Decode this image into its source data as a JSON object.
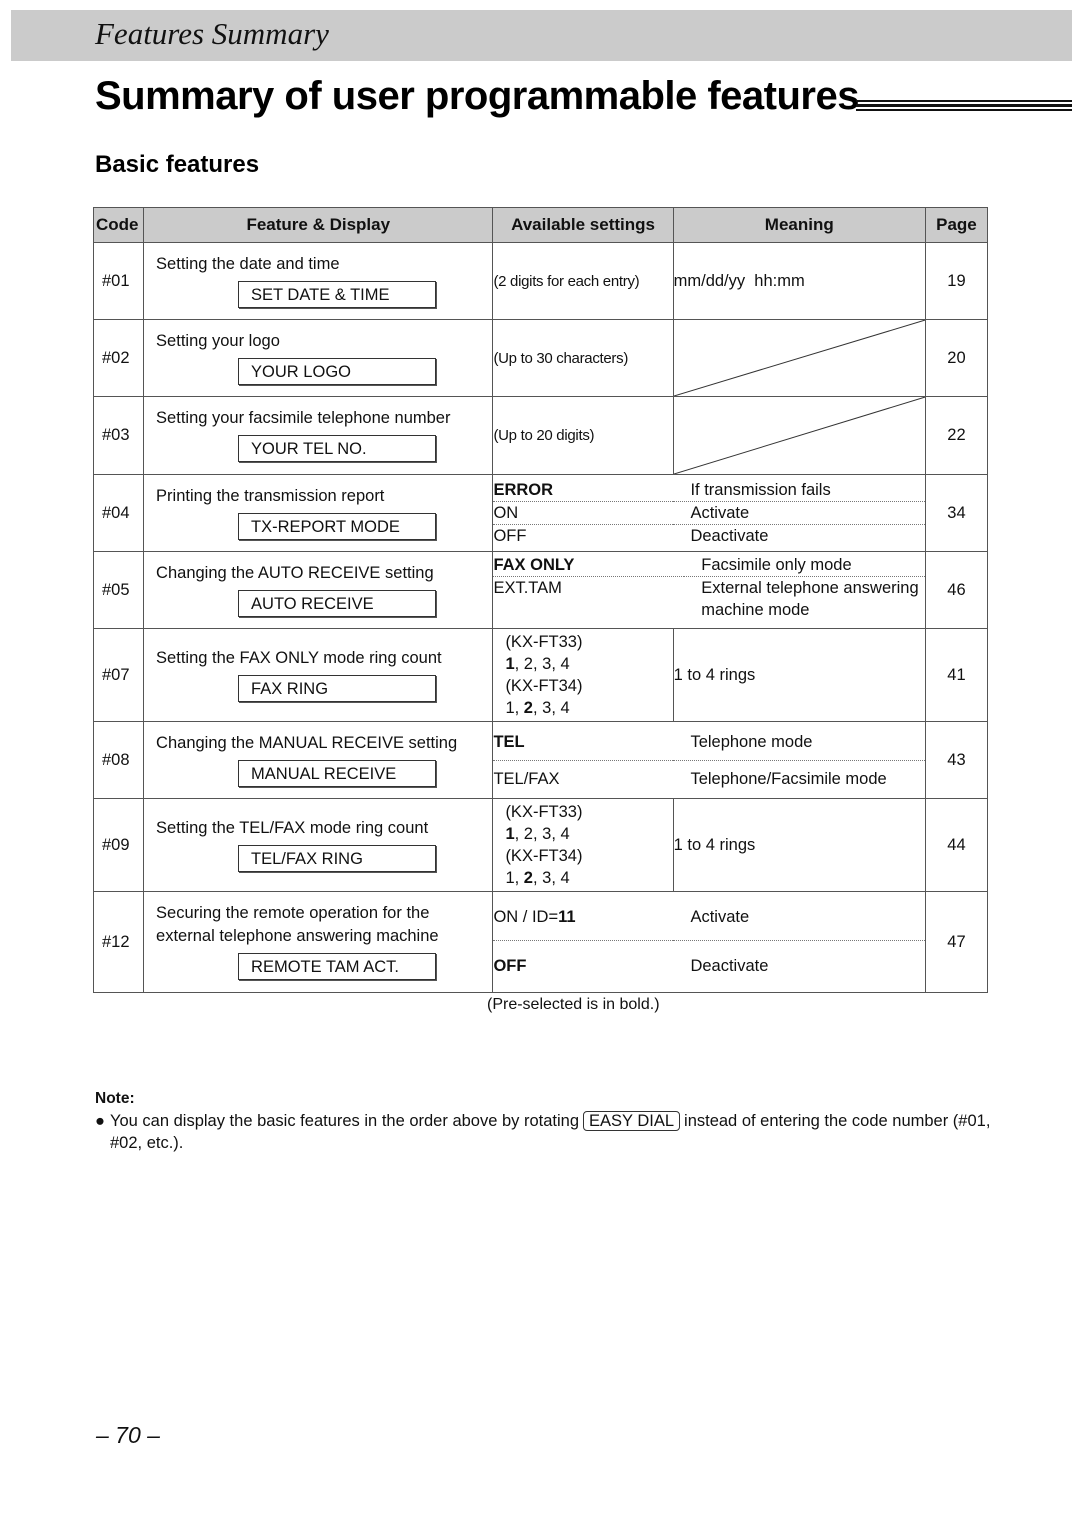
{
  "header": {
    "section": "Features Summary"
  },
  "main_title": "Summary of user programmable features",
  "section_title": "Basic features",
  "table": {
    "headers": {
      "code": "Code",
      "feature": "Feature & Display",
      "settings": "Available settings",
      "meaning": "Meaning",
      "page": "Page"
    },
    "rows": [
      {
        "code": "#01",
        "description": "Setting the date and time",
        "display": "SET DATE & TIME",
        "settings": "(2 digits for each entry)",
        "meaning": "mm/dd/yy  hh:mm",
        "page": "19"
      },
      {
        "code": "#02",
        "description": "Setting your logo",
        "display": "YOUR LOGO",
        "settings": "(Up to 30 characters)",
        "meaning": "",
        "page": "20"
      },
      {
        "code": "#03",
        "description": "Setting your facsimile telephone number",
        "display": "YOUR TEL NO.",
        "settings": "(Up to 20 digits)",
        "meaning": "",
        "page": "22"
      },
      {
        "code": "#04",
        "description": "Printing the transmission report",
        "display": "TX-REPORT MODE",
        "options": [
          {
            "setting": "ERROR",
            "bold": true,
            "meaning": "If transmission fails"
          },
          {
            "setting": "ON",
            "bold": false,
            "meaning": "Activate"
          },
          {
            "setting": "OFF",
            "bold": false,
            "meaning": "Deactivate"
          }
        ],
        "page": "34"
      },
      {
        "code": "#05",
        "description": "Changing the AUTO RECEIVE setting",
        "display": "AUTO RECEIVE",
        "options": [
          {
            "setting": "FAX ONLY",
            "bold": true,
            "meaning": "Facsimile only mode"
          },
          {
            "setting": "EXT.TAM",
            "bold": false,
            "meaning": "External telephone answering machine mode"
          }
        ],
        "page": "46"
      },
      {
        "code": "#07",
        "description": "Setting the FAX ONLY mode ring count",
        "display": "FAX RING",
        "models": [
          {
            "model": "(KX-FT33)",
            "default": "1",
            "values": [
              "1",
              "2",
              "3",
              "4"
            ]
          },
          {
            "model": "(KX-FT34)",
            "default": "2",
            "values": [
              "1",
              "2",
              "3",
              "4"
            ]
          }
        ],
        "meaning": "1 to 4 rings",
        "page": "41"
      },
      {
        "code": "#08",
        "description": "Changing the MANUAL RECEIVE setting",
        "display": "MANUAL RECEIVE",
        "options": [
          {
            "setting": "TEL",
            "bold": true,
            "meaning": "Telephone mode"
          },
          {
            "setting": "TEL/FAX",
            "bold": false,
            "meaning": "Telephone/Facsimile mode"
          }
        ],
        "page": "43"
      },
      {
        "code": "#09",
        "description": "Setting the TEL/FAX mode ring count",
        "display": "TEL/FAX RING",
        "models": [
          {
            "model": "(KX-FT33)",
            "default": "1",
            "values": [
              "1",
              "2",
              "3",
              "4"
            ]
          },
          {
            "model": "(KX-FT34)",
            "default": "2",
            "values": [
              "1",
              "2",
              "3",
              "4"
            ]
          }
        ],
        "meaning": "1 to 4 rings",
        "page": "44"
      },
      {
        "code": "#12",
        "description": "Securing the remote operation for the external telephone answering machine",
        "display": "REMOTE TAM ACT.",
        "options": [
          {
            "setting_prefix": "ON / ID=",
            "setting": "11",
            "bold": true,
            "meaning": "Activate"
          },
          {
            "setting": "OFF",
            "bold": true,
            "meaning": "Deactivate"
          }
        ],
        "page": "47"
      }
    ]
  },
  "footnote": "(Pre-selected is in bold.)",
  "note": {
    "label": "Note:",
    "bullet": "●",
    "text_before": "You can display the basic features in the order above by rotating",
    "key": "EASY DIAL",
    "text_after": "instead of entering the code number (#01, #02, etc.)."
  },
  "page_number": "– 70 –"
}
